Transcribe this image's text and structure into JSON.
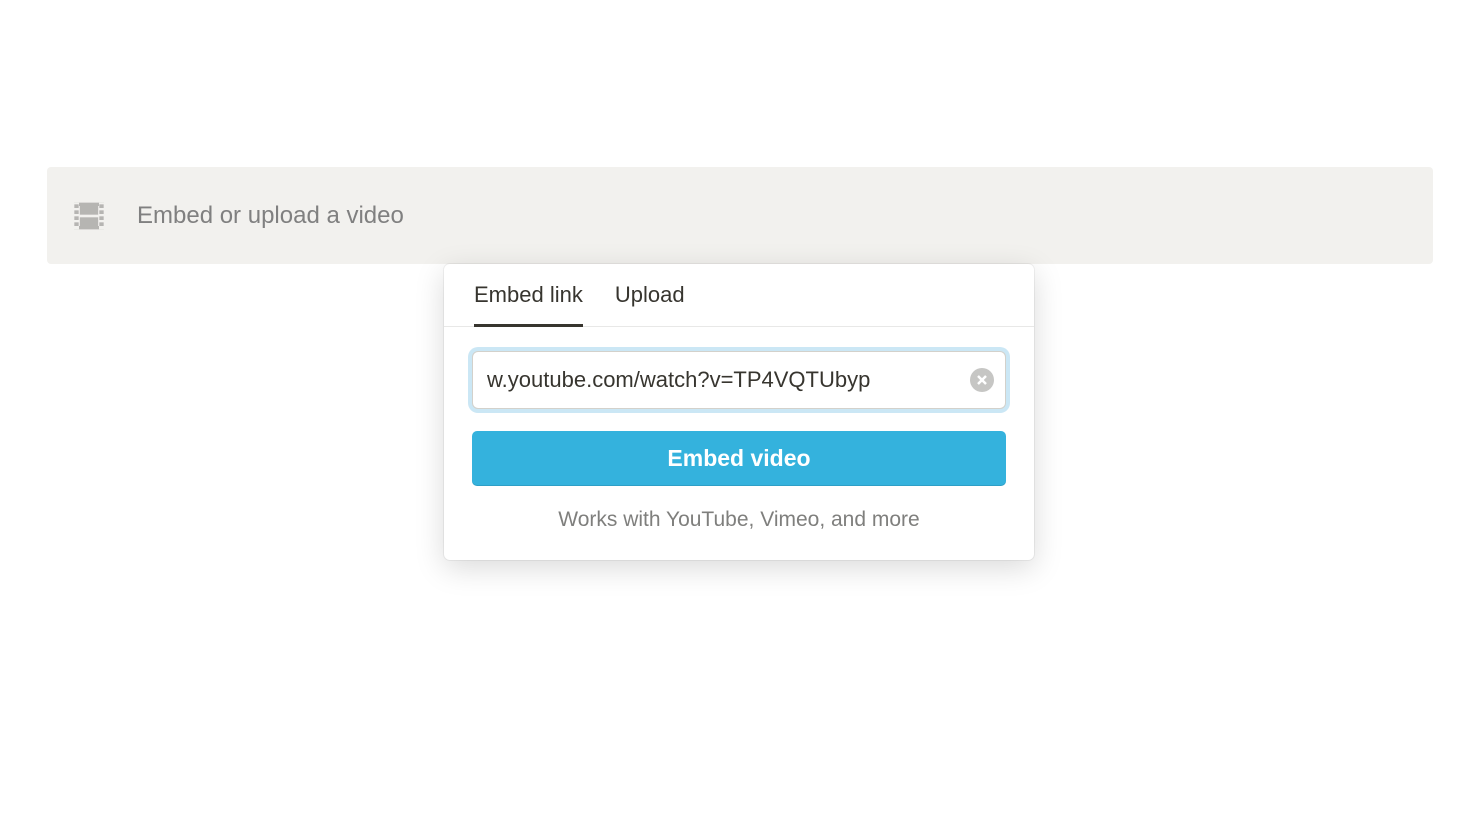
{
  "block": {
    "placeholder": "Embed or upload a video"
  },
  "popover": {
    "tabs": {
      "embed": "Embed link",
      "upload": "Upload"
    },
    "url_value": "w.youtube.com/watch?v=TP4VQTUbyp",
    "embed_button": "Embed video",
    "hint": "Works with YouTube, Vimeo, and more"
  },
  "colors": {
    "accent": "#34b2dd",
    "block_bg": "#f2f1ee"
  }
}
